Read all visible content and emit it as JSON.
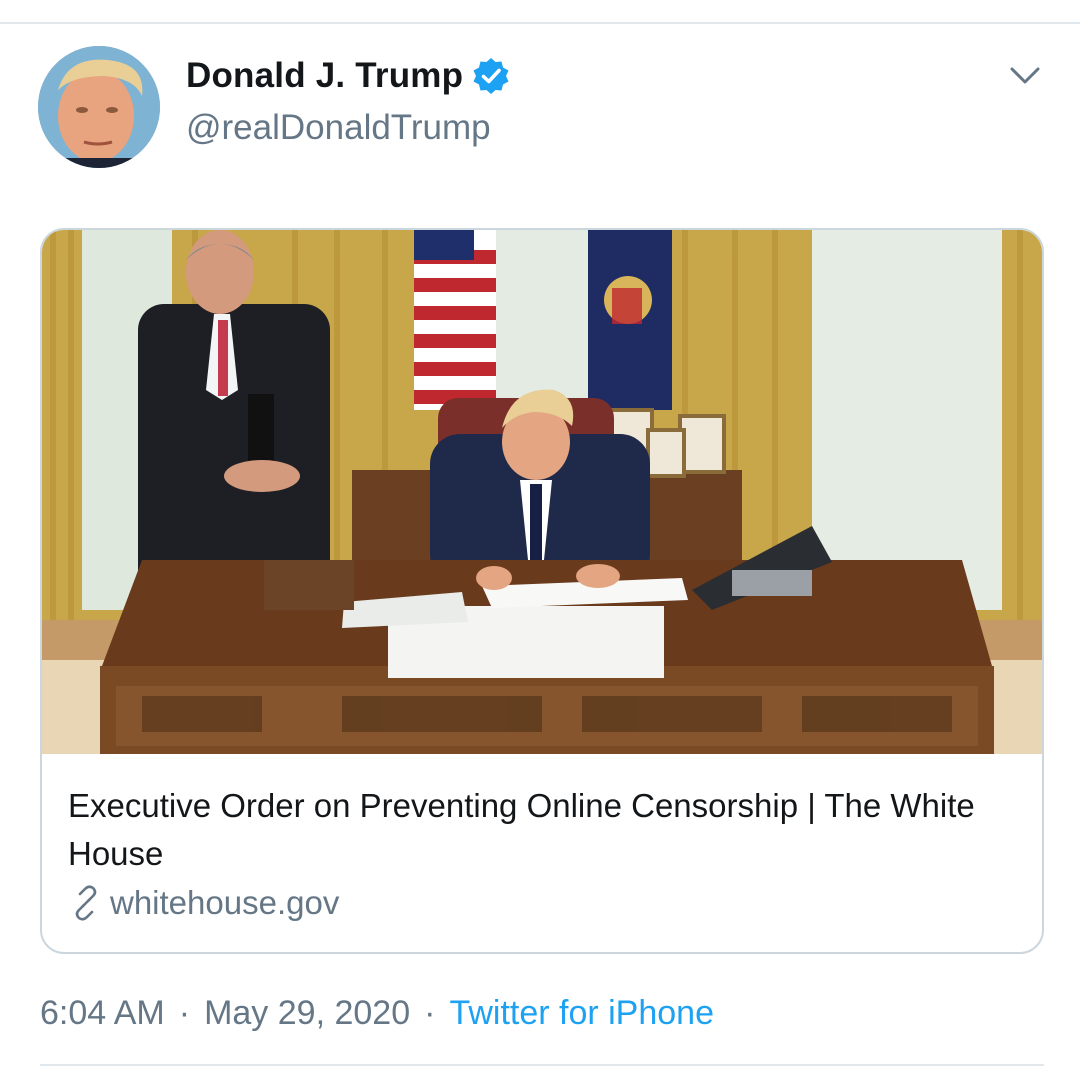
{
  "tweet": {
    "author": {
      "display_name": "Donald J. Trump",
      "handle": "@realDonaldTrump",
      "verified_icon": "verified-badge-icon"
    },
    "menu_icon": "chevron-down-icon",
    "link_card": {
      "title": "Executive Order on Preventing Online Censorship | The White House",
      "domain": "whitehouse.gov",
      "domain_icon": "link-icon"
    },
    "meta": {
      "time": "6:04 AM",
      "separator": "·",
      "date": "May 29, 2020",
      "source": "Twitter for iPhone"
    }
  },
  "colors": {
    "text_primary": "#14171a",
    "text_secondary": "#657786",
    "accent": "#1da1f2",
    "border": "#ccd6dd",
    "divider": "#e1e8ed"
  }
}
